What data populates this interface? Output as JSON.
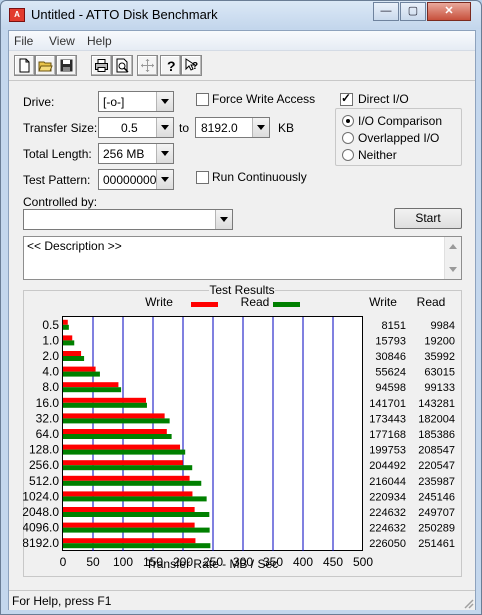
{
  "window": {
    "title": "Untitled - ATTO Disk Benchmark",
    "minimize": "—",
    "maximize": "▢",
    "close": "✕"
  },
  "menu": [
    "File",
    "View",
    "Help"
  ],
  "toolbar": [
    "new-file-icon",
    "open-folder-icon",
    "save-icon",
    "print-icon",
    "print-preview-icon",
    "move-icon",
    "help-icon",
    "context-help-icon"
  ],
  "form": {
    "drive_label": "Drive:",
    "drive_value": "[-o-]",
    "force_write_label": "Force Write Access",
    "force_write_checked": false,
    "direct_io_label": "Direct I/O",
    "direct_io_checked": true,
    "transfer_size_label": "Transfer Size:",
    "transfer_from": "0.5",
    "to_label": "to",
    "transfer_to": "8192.0",
    "transfer_unit": "KB",
    "total_length_label": "Total Length:",
    "total_length_value": "256 MB",
    "test_pattern_label": "Test Pattern:",
    "test_pattern_value": "00000000",
    "run_continuously_label": "Run Continuously",
    "run_continuously_checked": false,
    "io_options": [
      "I/O Comparison",
      "Overlapped I/O",
      "Neither"
    ],
    "io_selected": 0,
    "controlled_by_label": "Controlled by:",
    "controlled_by_value": "",
    "start_label": "Start",
    "description": "<< Description >>"
  },
  "results": {
    "group_title": "Test Results",
    "write_col": "Write",
    "read_col": "Read",
    "legend_write": "Write",
    "legend_read": "Read"
  },
  "chart_data": {
    "type": "bar",
    "orientation": "horizontal",
    "xlabel": "Transfer Rate - MB / Sec",
    "xlim": [
      0,
      500
    ],
    "xticks": [
      "0",
      "50",
      "100",
      "150",
      "200",
      "250",
      "300",
      "350",
      "400",
      "450",
      "500"
    ],
    "categories": [
      "0.5",
      "1.0",
      "2.0",
      "4.0",
      "8.0",
      "16.0",
      "32.0",
      "64.0",
      "128.0",
      "256.0",
      "512.0",
      "1024.0",
      "2048.0",
      "4096.0",
      "8192.0"
    ],
    "series": [
      {
        "name": "Write",
        "color": "#ff0000",
        "values": [
          8151,
          15793,
          30846,
          55624,
          94598,
          141701,
          173443,
          177168,
          199753,
          204492,
          216044,
          220934,
          224632,
          224632,
          226050
        ],
        "display": [
          "8151",
          "15793",
          "30846",
          "55624",
          "94598",
          "141701",
          "173443",
          "177168",
          "199753",
          "204492",
          "216044",
          "220934",
          "224632",
          "224632",
          "226050"
        ]
      },
      {
        "name": "Read",
        "color": "#008000",
        "values": [
          9984,
          19200,
          35992,
          63015,
          99133,
          143281,
          182004,
          185386,
          208547,
          220547,
          235987,
          245146,
          249707,
          250289,
          251461
        ],
        "display": [
          "9984",
          "19200",
          "35992",
          "63015",
          "99133",
          "143281",
          "182004",
          "185386",
          "208547",
          "220547",
          "235987",
          "245146",
          "249707",
          "250289",
          "251461"
        ]
      }
    ],
    "value_units": "KB/s",
    "grid": true
  },
  "status": {
    "text": "For Help, press F1"
  }
}
